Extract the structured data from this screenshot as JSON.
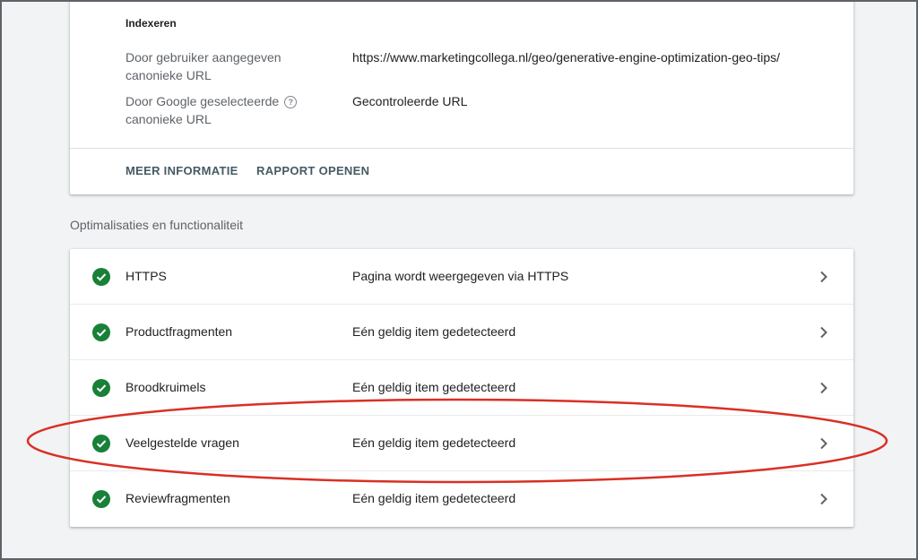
{
  "index_card": {
    "section_title": "Indexeren",
    "fields": [
      {
        "label": "Door gebruiker aangegeven canonieke URL",
        "value": "https://www.marketingcollega.nl/geo/generative-engine-optimization-geo-tips/",
        "help": false
      },
      {
        "label": "Door Google geselecteerde canonieke URL",
        "value": "Gecontroleerde URL",
        "help": true
      }
    ],
    "buttons": {
      "more_info": "MEER INFORMATIE",
      "open_report": "RAPPORT OPENEN"
    }
  },
  "optimizations": {
    "title": "Optimalisaties en functionaliteit",
    "items": [
      {
        "name": "HTTPS",
        "status": "Pagina wordt weergegeven via HTTPS"
      },
      {
        "name": "Productfragmenten",
        "status": "Eén geldig item gedetecteerd"
      },
      {
        "name": "Broodkruimels",
        "status": "Eén geldig item gedetecteerd"
      },
      {
        "name": "Veelgestelde vragen",
        "status": "Eén geldig item gedetecteerd"
      },
      {
        "name": "Reviewfragmenten",
        "status": "Eén geldig item gedetecteerd"
      }
    ]
  },
  "icons": {
    "status": "check-circle-icon",
    "row_action": "chevron-right-icon",
    "help": "help-icon"
  },
  "colors": {
    "success": "#188038",
    "annotation": "#d93025",
    "button_text": "#455a64"
  }
}
